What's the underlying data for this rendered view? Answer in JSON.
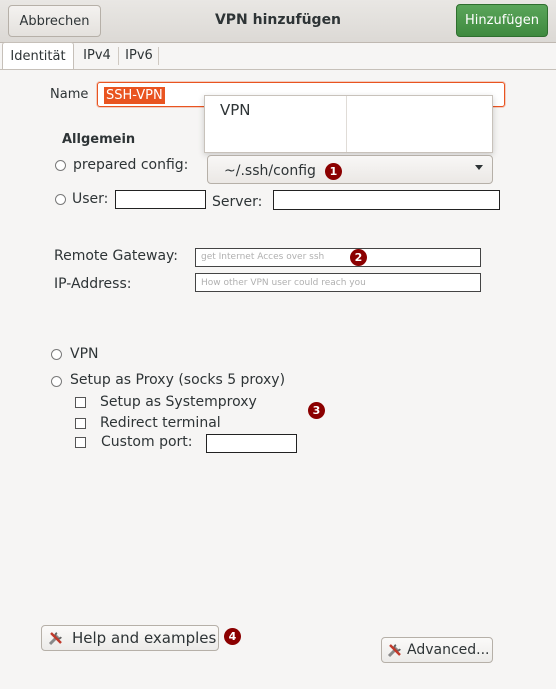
{
  "header": {
    "cancel_label": "Abbrechen",
    "title": "VPN hinzufügen",
    "add_label": "Hinzufügen"
  },
  "tabs": [
    {
      "label": "Identität",
      "active": true
    },
    {
      "label": "IPv4",
      "active": false
    },
    {
      "label": "IPv6",
      "active": false
    }
  ],
  "identity": {
    "name_label": "Name",
    "name_value": "SSH-VPN",
    "type_popup_item": "VPN",
    "section_general": "Allgemein",
    "prepared_config_label": "prepared config:",
    "config_value": "~/.ssh/config",
    "user_label": "User:",
    "server_label": "Server:",
    "remote_gateway_label": "Remote Gateway:",
    "remote_gateway_placeholder": "get Internet Acces over ssh",
    "ip_address_label": "IP-Address:",
    "ip_address_placeholder": "How other VPN user could reach you",
    "mode_vpn_label": "VPN",
    "mode_proxy_label": "Setup as Proxy (socks 5 proxy)",
    "systemproxy_label": "Setup as Systemproxy",
    "redirect_terminal_label": "Redirect terminal",
    "custom_port_label": "Custom port:"
  },
  "markers": [
    "1",
    "2",
    "3",
    "4"
  ],
  "footer": {
    "help_label": "Help and examples",
    "advanced_label": "Advanced..."
  },
  "colors": {
    "accent": "#e95420",
    "suggested_action": "#4e9a4e",
    "marker": "#8b0000"
  }
}
